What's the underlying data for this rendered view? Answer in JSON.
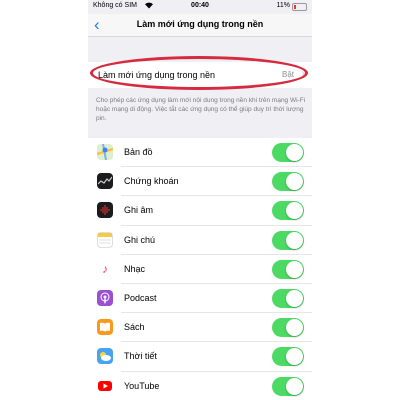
{
  "status_bar": {
    "carrier": "Không có SIM",
    "time": "00:40",
    "battery": "11%"
  },
  "nav": {
    "title": "Làm mới ứng dụng trong nền"
  },
  "main_setting": {
    "label": "Làm mới ứng dụng trong nền",
    "value": "Bật"
  },
  "footnote": "Cho phép các ứng dụng làm mới nội dung trong nền khi trên mạng Wi-Fi hoặc mạng di động. Việc tắt các ứng dụng có thể giúp duy trì thời lượng pin.",
  "colors": {
    "accent": "#1a7cf5",
    "toggle_on": "#4cd964",
    "highlight": "#d62b3f"
  },
  "apps": [
    {
      "label": "Bản đồ",
      "icon": "maps-icon",
      "on": true
    },
    {
      "label": "Chứng khoán",
      "icon": "stocks-icon",
      "on": true
    },
    {
      "label": "Ghi âm",
      "icon": "voice-memos-icon",
      "on": true
    },
    {
      "label": "Ghi chú",
      "icon": "notes-icon",
      "on": true
    },
    {
      "label": "Nhạc",
      "icon": "music-icon",
      "on": true
    },
    {
      "label": "Podcast",
      "icon": "podcast-icon",
      "on": true
    },
    {
      "label": "Sách",
      "icon": "books-icon",
      "on": true
    },
    {
      "label": "Thời tiết",
      "icon": "weather-icon",
      "on": true
    },
    {
      "label": "YouTube",
      "icon": "youtube-icon",
      "on": true
    }
  ]
}
